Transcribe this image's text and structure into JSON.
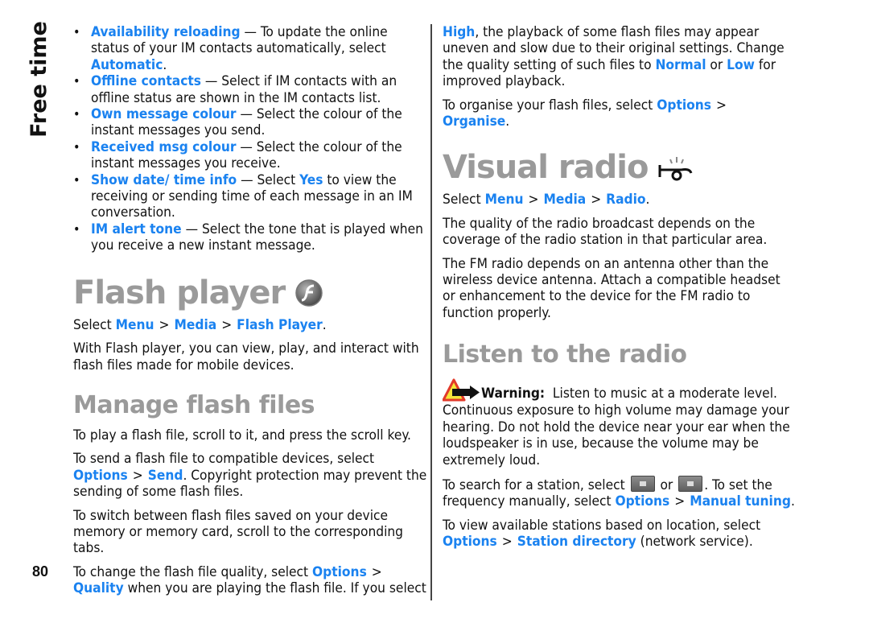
{
  "side_title": "Free time",
  "page_number": "80",
  "colors": {
    "link": "#1a82f0",
    "heading": "#9a9a9a",
    "text": "#111111"
  },
  "left": {
    "options": [
      {
        "term": "Availability reloading",
        "text": " — To update the online status of your IM contacts automatically, select ",
        "value": "Automatic",
        "tail": "."
      },
      {
        "term": "Offline contacts",
        "text": " — Select if IM contacts with an offline status are shown in the IM contacts list."
      },
      {
        "term": "Own message colour",
        "text": " — Select the colour of the instant messages you send."
      },
      {
        "term": "Received msg colour",
        "text": " — Select the colour of the instant messages you receive."
      },
      {
        "term": "Show date/ time info",
        "text": " — Select ",
        "value": "Yes",
        "tail": " to view the receiving or sending time of each message in an IM conversation."
      },
      {
        "term": "IM alert tone",
        "text": " — Select the tone that is played when you receive a new instant message."
      }
    ],
    "flash_player": {
      "title": "Flash player",
      "icon": "flash-player-icon",
      "path_prefix": "Select ",
      "path": [
        "Menu",
        "Media",
        "Flash Player"
      ],
      "intro": "With Flash player, you can view, play, and interact with flash files made for mobile devices."
    },
    "manage": {
      "title": "Manage flash files",
      "p1": "To play a flash file, scroll to it, and press the scroll key.",
      "p2_prefix": "To send a flash file to compatible devices, select ",
      "p2_path": [
        "Options",
        "Send"
      ],
      "p2_suffix": ". Copyright protection may prevent the sending of some flash files.",
      "p3": "To switch between flash files saved on your device memory or memory card, scroll to the corresponding tabs.",
      "p4_prefix": "To change the flash file quality, select ",
      "p4_path": [
        "Options",
        "Quality"
      ],
      "p4_suffix": " when you are playing the flash file. If you select "
    }
  },
  "right": {
    "quality_cont": {
      "value_high": "High",
      "text1": ", the playback of some flash files may appear uneven and slow due to their original settings. Change the quality setting of such files to ",
      "value_normal": "Normal",
      "or": " or ",
      "value_low": "Low",
      "text2": " for improved playback."
    },
    "organise": {
      "prefix": "To organise your flash files, select ",
      "path": [
        "Options",
        "Organise"
      ],
      "suffix": "."
    },
    "visual_radio": {
      "title": "Visual radio",
      "icon": "radio-icon",
      "path_prefix": "Select ",
      "path": [
        "Menu",
        "Media",
        "Radio"
      ],
      "p1": "The quality of the radio broadcast depends on the coverage of the radio station in that particular area.",
      "p2": "The FM radio depends on an antenna other than the wireless device antenna. Attach a compatible headset or enhancement to the device for the FM radio to function properly."
    },
    "listen": {
      "title": "Listen to the radio",
      "warning_label": "Warning:",
      "warning_text": "  Listen to music at a moderate level. Continuous exposure to high volume may damage your hearing. Do not hold the device near your ear when the loudspeaker is in use, because the volume may be extremely loud.",
      "search_prefix": "To search for a station, select ",
      "search_or": " or ",
      "search_suffix": ". To set the frequency manually, select ",
      "manual_path": [
        "Options",
        "Manual tuning"
      ],
      "station_prefix": "To view available stations based on location, select ",
      "station_path": [
        "Options",
        "Station directory"
      ],
      "station_suffix": " (network service)."
    }
  }
}
